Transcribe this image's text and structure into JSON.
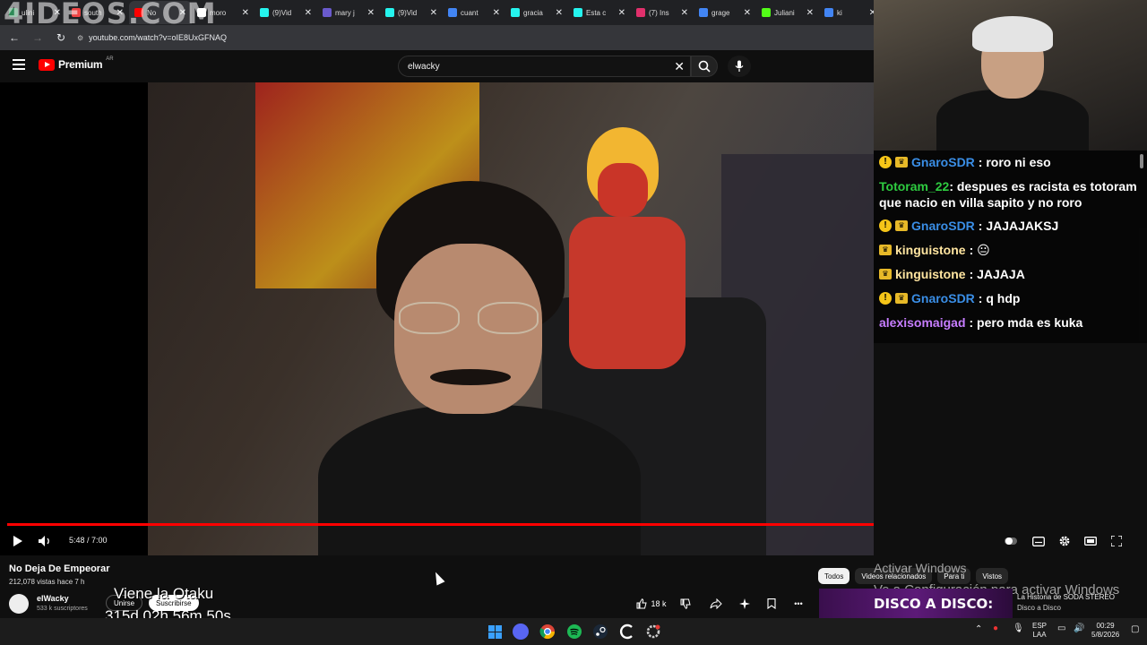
{
  "watermark": "4IDEOS.COM",
  "browser": {
    "tabs": [
      {
        "label": "ulini",
        "color": "#2e8b57"
      },
      {
        "label": "south",
        "color": "#e44"
      },
      {
        "label": "No ",
        "color": "#ff0000"
      },
      {
        "label": "moro",
        "color": "#fff"
      },
      {
        "label": "(9)Vid",
        "color": "#25f4ee"
      },
      {
        "label": "mary j",
        "color": "#6a5acd"
      },
      {
        "label": "(9)Vid",
        "color": "#25f4ee"
      },
      {
        "label": "cuant",
        "color": "#4285f4"
      },
      {
        "label": "gracia",
        "color": "#25f4ee"
      },
      {
        "label": "Esta c",
        "color": "#25f4ee"
      },
      {
        "label": "(7) Ins",
        "color": "#e1306c"
      },
      {
        "label": "grage",
        "color": "#4285f4"
      },
      {
        "label": "Juliani",
        "color": "#53fc18"
      },
      {
        "label": "ki",
        "color": "#4285f4"
      }
    ],
    "close_glyph": "✕",
    "url": "youtube.com/watch?v=oIE8UxGFNAQ"
  },
  "youtube": {
    "brand": "Premium",
    "region": "AR",
    "search_query": "elwacky"
  },
  "player": {
    "current_time": "5:48",
    "duration": "7:00",
    "time_display": "5:48 / 7:00",
    "progress_fraction": 0.829
  },
  "chat": {
    "messages": [
      {
        "user": "GnaroSDR",
        "user_color": "#3a8ee6",
        "badges": true,
        "text": ": roro ni eso"
      },
      {
        "user": "Totoram_22",
        "user_color": "#2ecc40",
        "badges": false,
        "text": ": despues es racista es totoram que nacio en villa sapito y no roro"
      },
      {
        "user": "GnaroSDR",
        "user_color": "#3a8ee6",
        "badges": true,
        "text": ": JAJAJAKSJ"
      },
      {
        "user": "kinguistone",
        "user_color": "#ffe5a0",
        "badges": "crown",
        "text": ": 😐"
      },
      {
        "user": "kinguistone",
        "user_color": "#ffe5a0",
        "badges": "crown",
        "text": ": JAJAJA"
      },
      {
        "user": "GnaroSDR",
        "user_color": "#3a8ee6",
        "badges": true,
        "text": ": q hdp"
      },
      {
        "user": "alexisomaigad",
        "user_color": "#c77dff",
        "badges": false,
        "text": ": pero mda es kuka"
      }
    ]
  },
  "video": {
    "title": "No Deja De Empeorar",
    "meta": "212,078 vistas  hace 7 h",
    "channel": "elWacky",
    "subscribers": "533 k suscriptores",
    "join_label": "Unirse",
    "subscribe_label": "Suscribirse",
    "likes": "18 k"
  },
  "overlay_text": {
    "title": "Viene la Otaku",
    "countdown": "315d 02h 56m 50s"
  },
  "sidebar": {
    "chips": [
      "Todos",
      "Videos relacionados",
      "Para ti",
      "Vistos"
    ],
    "activate_line1": "Activar Windows",
    "activate_line2": "Ve a Configuración para activar Windows",
    "rec_thumb_text": "DISCO A DISCO:",
    "rec_title": "La Historia de SODA STEREO",
    "rec_sub": "Disco a Disco"
  },
  "taskbar": {
    "lang": "ESP",
    "lang2": "LAA",
    "time": "00:29",
    "date": "5/8/2026"
  }
}
